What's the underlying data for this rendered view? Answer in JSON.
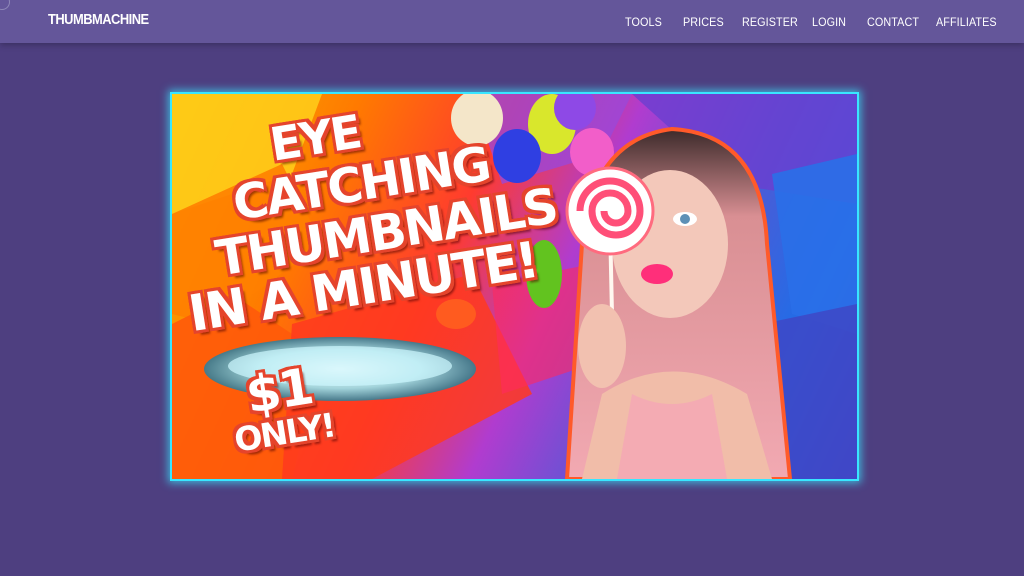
{
  "header": {
    "logo": "THUMBMACHINE",
    "nav": {
      "tools": "TOOLS",
      "prices": "PRICES",
      "register": "REGISTER",
      "login": "LOGIN",
      "contact": "CONTACT",
      "affiliates": "AFFILIATES"
    }
  },
  "hero": {
    "headline": [
      "EYE",
      "CATCHING",
      "THUMBNAILS",
      "IN A MINUTE!"
    ],
    "price": "$1",
    "price_note": "ONLY!"
  },
  "colors": {
    "page_background": "#4e3f80",
    "header_background": "#64569a",
    "hero_border": "#39e6ff",
    "headline_outline": "#e5442c"
  }
}
